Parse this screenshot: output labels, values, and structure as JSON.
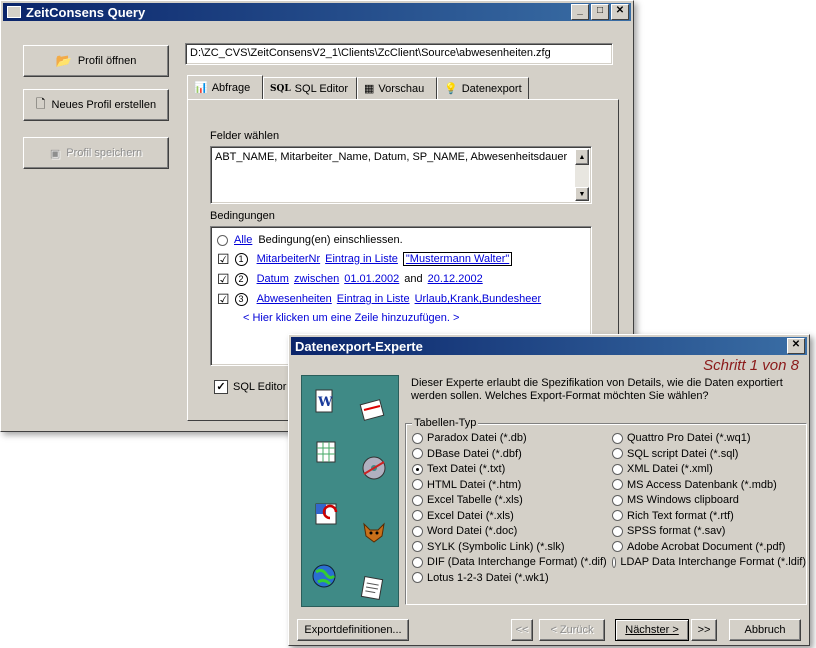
{
  "main_window": {
    "title": "ZeitConsens Query",
    "window_buttons": {
      "minimize": "_",
      "maximize": "□",
      "close": "✕"
    },
    "buttons": {
      "open_profile": "Profil öffnen",
      "new_profile": "Neues Profil erstellen",
      "save_profile": "Profil speichern"
    },
    "path_value": "D:\\ZC_CVS\\ZeitConsensV2_1\\Clients\\ZcClient\\Source\\abwesenheiten.zfg",
    "tabs": [
      {
        "label": "Abfrage",
        "icon": "chart-icon",
        "active": true
      },
      {
        "label": "SQL Editor",
        "icon": "sql-icon",
        "prefix": "SQL",
        "active": false
      },
      {
        "label": "Vorschau",
        "icon": "preview-icon",
        "active": false
      },
      {
        "label": "Datenexport",
        "icon": "lightbulb-icon",
        "active": false
      }
    ],
    "fields_label": "Felder wählen",
    "fields_value": "ABT_NAME, Mitarbeiter_Name, Datum, SP_NAME, Abwesenheitsdauer",
    "conditions_label": "Bedingungen",
    "conditions": {
      "all_link": "Alle",
      "all_text": "Bedingung(en) einschliessen.",
      "rows": [
        {
          "num": "1",
          "field": "MitarbeiterNr",
          "op": "Eintrag in Liste",
          "value": "\"Mustermann Walter\"",
          "checked": "☑"
        },
        {
          "num": "2",
          "field": "Datum",
          "op": "zwischen",
          "value1": "01.01.2002",
          "and": "and",
          "value2": "20.12.2002",
          "checked": "☑"
        },
        {
          "num": "3",
          "field": "Abwesenheiten",
          "op": "Eintrag in Liste",
          "value": "Urlaub,Krank,Bundesheer",
          "checked": "☑"
        }
      ],
      "add_hint": "< Hier klicken um eine Zeile hinzuzufügen. >"
    },
    "sql_editor_checkbox": "SQL Editor"
  },
  "export_dialog": {
    "title": "Datenexport-Experte",
    "step": "Schritt 1 von 8",
    "description": "Dieser Experte erlaubt die Spezifikation von Details, wie die Daten exportiert werden sollen. Welches Export-Format möchten Sie wählen?",
    "group_label": "Tabellen-Typ",
    "options_left": [
      {
        "label": "Paradox Datei (*.db)",
        "selected": false
      },
      {
        "label": "DBase Datei (*.dbf)",
        "selected": false
      },
      {
        "label": "Text Datei (*.txt)",
        "selected": true
      },
      {
        "label": "HTML Datei (*.htm)",
        "selected": false
      },
      {
        "label": "Excel Tabelle (*.xls)",
        "selected": false
      },
      {
        "label": "Excel Datei (*.xls)",
        "selected": false
      },
      {
        "label": "Word Datei (*.doc)",
        "selected": false
      },
      {
        "label": "SYLK (Symbolic Link) (*.slk)",
        "selected": false
      },
      {
        "label": "DIF (Data Interchange Format) (*.dif)",
        "selected": false
      },
      {
        "label": "Lotus 1-2-3 Datei (*.wk1)",
        "selected": false
      }
    ],
    "options_right": [
      {
        "label": "Quattro Pro Datei (*.wq1)",
        "selected": false
      },
      {
        "label": "SQL script Datei (*.sql)",
        "selected": false
      },
      {
        "label": "XML Datei (*.xml)",
        "selected": false
      },
      {
        "label": "MS Access Datenbank (*.mdb)",
        "selected": false
      },
      {
        "label": "MS Windows clipboard",
        "selected": false
      },
      {
        "label": "Rich Text format (*.rtf)",
        "selected": false
      },
      {
        "label": "SPSS format (*.sav)",
        "selected": false
      },
      {
        "label": "Adobe Acrobat Document (*.pdf)",
        "selected": false
      },
      {
        "label": "LDAP Data Interchange Format (*.ldif)",
        "selected": false
      }
    ],
    "buttons": {
      "export_definitions": "Exportdefinitionen...",
      "first": "<<",
      "back": "< Zurück",
      "next": "Nächster >",
      "last": ">>",
      "cancel": "Abbruch"
    },
    "close": "✕"
  },
  "colors": {
    "titlebar": "#0a246a",
    "face": "#d4d0c8",
    "link": "#0000d8",
    "step_text": "#8b1a1a",
    "sidebar": "#3f8a86"
  }
}
